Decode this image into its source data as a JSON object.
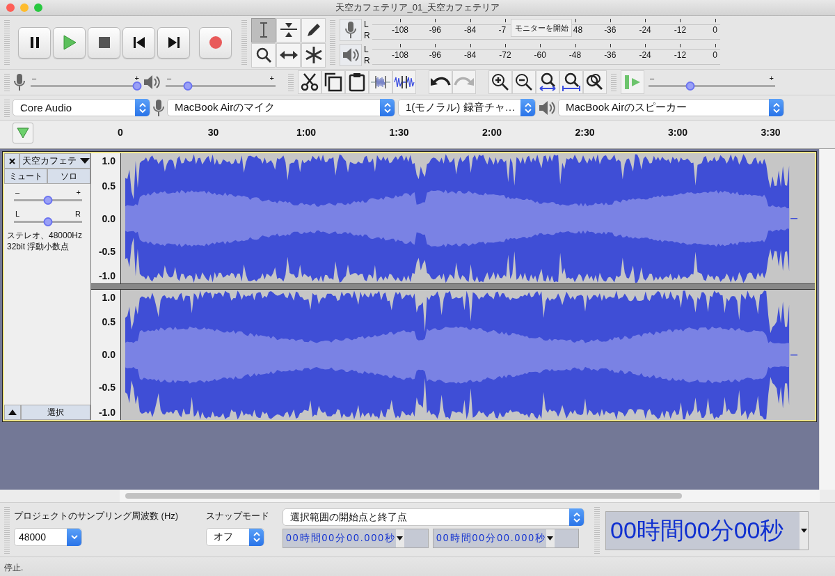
{
  "window": {
    "title": "天空カフェテリア_01_天空カフェテリア"
  },
  "transport": [
    {
      "kind": "pause"
    },
    {
      "kind": "play"
    },
    {
      "kind": "stop"
    },
    {
      "kind": "skip-start"
    },
    {
      "kind": "skip-end"
    },
    {
      "kind": "record"
    }
  ],
  "tools": [
    {
      "kind": "select",
      "selected": true
    },
    {
      "kind": "envelope",
      "selected": false
    },
    {
      "kind": "draw",
      "selected": false
    },
    {
      "kind": "zoom",
      "selected": false
    },
    {
      "kind": "timeshift",
      "selected": false
    },
    {
      "kind": "multi",
      "selected": false
    }
  ],
  "meters": [
    {
      "kind": "record",
      "channels": [
        "L",
        "R"
      ],
      "ticks": [
        "-108",
        "-96",
        "-84",
        "-7",
        "48",
        "-36",
        "-24",
        "-12",
        "0"
      ],
      "overlay": "モニターを開始"
    },
    {
      "kind": "playback",
      "channels": [
        "L",
        "R"
      ],
      "ticks": [
        "-108",
        "-96",
        "-84",
        "-72",
        "-60",
        "-48",
        "-36",
        "-24",
        "-12",
        "0"
      ]
    }
  ],
  "mixer": [
    {
      "kind": "record",
      "min": "–",
      "max": "+",
      "level": 0.97
    },
    {
      "kind": "playback",
      "min": "–",
      "max": "+",
      "level": 0.2
    }
  ],
  "edit_buttons": [
    {
      "kind": "cut"
    },
    {
      "kind": "copy"
    },
    {
      "kind": "paste"
    },
    {
      "kind": "trim"
    },
    {
      "kind": "silence"
    }
  ],
  "history_buttons": [
    {
      "kind": "undo",
      "disabled": false
    },
    {
      "kind": "redo",
      "disabled": true
    }
  ],
  "zoom_buttons": [
    {
      "kind": "zoom-in"
    },
    {
      "kind": "zoom-out"
    },
    {
      "kind": "fit-selection"
    },
    {
      "kind": "fit-project"
    },
    {
      "kind": "zoom-toggle"
    }
  ],
  "play_at_speed": {
    "min": "–",
    "max": "+",
    "level": 0.33
  },
  "devices": [
    {
      "kind": "host",
      "value": "Core Audio"
    },
    {
      "kind": "input",
      "value": "MacBook Airのマイク"
    },
    {
      "kind": "channels",
      "value": "1(モノラル) 録音チャ…"
    },
    {
      "kind": "output",
      "value": "MacBook Airのスピーカー"
    }
  ],
  "ruler": {
    "labels": [
      "0",
      "30",
      "1:00",
      "1:30",
      "2:00",
      "2:30",
      "3:00",
      "3:30"
    ]
  },
  "track": {
    "name": "天空カフェテ",
    "mute": "ミュート",
    "solo": "ソロ",
    "gain": {
      "min": "–",
      "max": "+",
      "level": 0.5
    },
    "pan": {
      "min": "L",
      "max": "R",
      "level": 0.5
    },
    "info": [
      "ステレオ、48000Hz",
      "32bit 浮動小数点"
    ],
    "select": "選択",
    "channels": [
      {
        "scale": [
          "1.0",
          "0.5",
          "0.0",
          "-0.5",
          "-1.0"
        ]
      },
      {
        "scale": [
          "1.0",
          "0.5",
          "0.0",
          "-0.5",
          "-1.0"
        ]
      }
    ]
  },
  "selection_toolbar": {
    "rate_label": "プロジェクトのサンプリング周波数 (Hz)",
    "rate": "48000",
    "snap_label": "スナップモード",
    "snap": "オフ",
    "mode": "選択範囲の開始点と終了点",
    "start": "00時間00分00.000秒",
    "end": "00時間00分00.000秒"
  },
  "time_display": "00時間00分00秒",
  "status_bar": "停止."
}
